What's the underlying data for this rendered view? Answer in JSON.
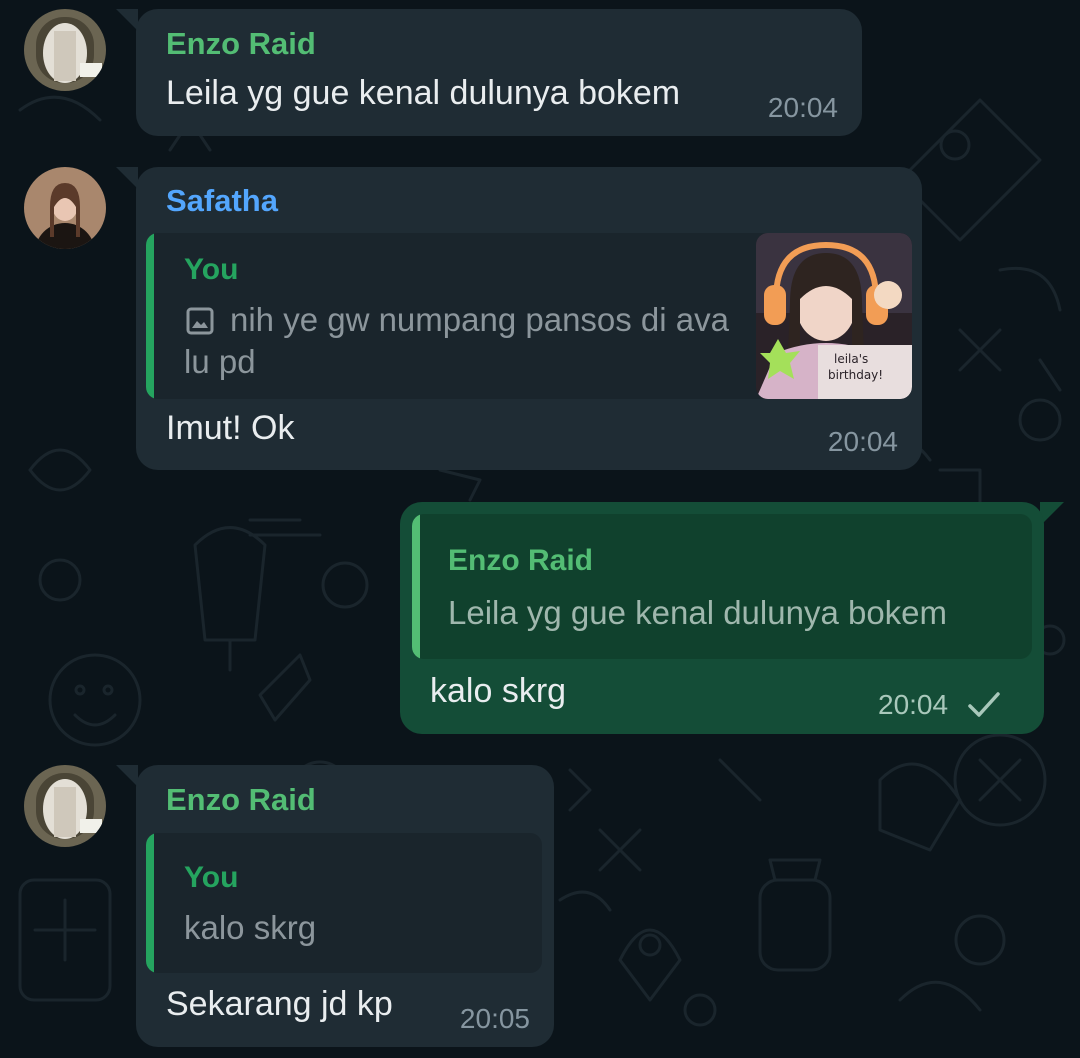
{
  "colors": {
    "background": "#0b141a",
    "incoming_bubble": "#1f2c34",
    "outgoing_bubble": "#144d37",
    "enzo_name": "#53bd74",
    "safatha_name": "#53a6fd",
    "you_name": "#25a45f",
    "time": "#8696a0"
  },
  "messages": [
    {
      "sender": "Enzo Raid",
      "text": "Leila yg gue kenal dulunya bokem",
      "time": "20:04"
    },
    {
      "sender": "Safatha",
      "quote": {
        "author": "You",
        "icon": "image-icon",
        "text": "nih ye gw numpang pansos di ava lu pd",
        "thumbnail_caption": "leila's birthday!"
      },
      "text": "Imut! Ok",
      "time": "20:04"
    },
    {
      "sender": "You",
      "quote": {
        "author": "Enzo Raid",
        "text": "Leila yg gue kenal dulunya bokem"
      },
      "text": "kalo skrg",
      "time": "20:04",
      "status_icon": "single-check-icon"
    },
    {
      "sender": "Enzo Raid",
      "quote": {
        "author": "You",
        "text": "kalo skrg"
      },
      "text": "Sekarang jd kp",
      "time": "20:05"
    }
  ]
}
